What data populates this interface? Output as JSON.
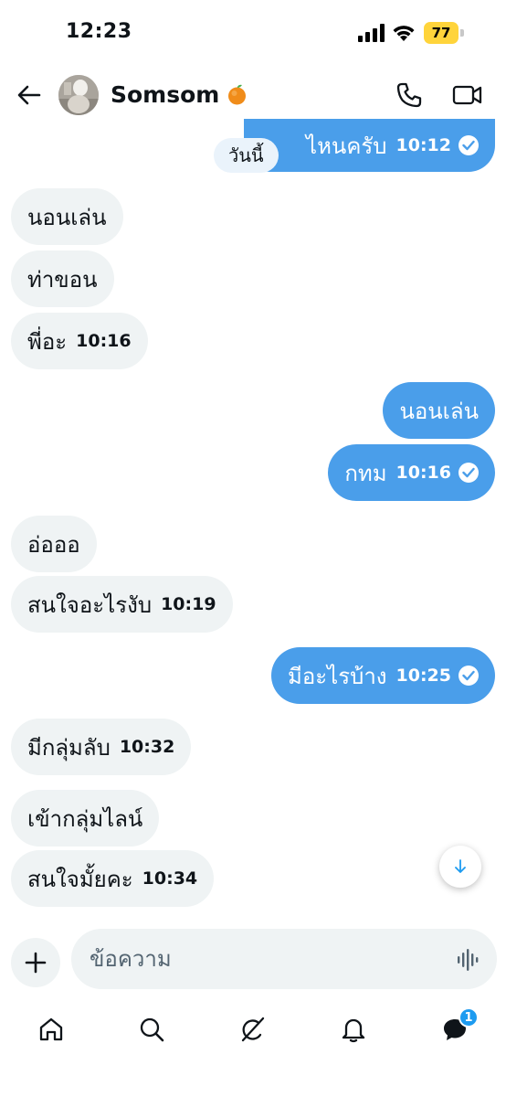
{
  "status_bar": {
    "time": "12:23",
    "battery": "77",
    "battery_color": "#ffd43b"
  },
  "header": {
    "contact_name": "Somsom",
    "contact_emoji": "orange-emoji"
  },
  "colors": {
    "outgoing": "#4a9eea",
    "incoming": "#eff3f4",
    "accent": "#1d9bf0"
  },
  "date_separator": "วันนี้",
  "messages": [
    {
      "text": "ไหนครับ",
      "time": "10:12",
      "direction": "out",
      "read": true
    },
    {
      "text": "นอนเล่น",
      "time": "",
      "direction": "in"
    },
    {
      "text": "ท่าขอน",
      "time": "",
      "direction": "in"
    },
    {
      "text": "พี่อะ",
      "time": "10:16",
      "direction": "in"
    },
    {
      "text": "นอนเล่น",
      "time": "",
      "direction": "out"
    },
    {
      "text": "กทม",
      "time": "10:16",
      "direction": "out",
      "read": true
    },
    {
      "text": "อ่อออ",
      "time": "",
      "direction": "in"
    },
    {
      "text": "สนใจอะไรงับ",
      "time": "10:19",
      "direction": "in"
    },
    {
      "text": "มีอะไรบ้าง",
      "time": "10:25",
      "direction": "out",
      "read": true
    },
    {
      "text": "มีกลุ่มลับ",
      "time": "10:32",
      "direction": "in"
    },
    {
      "text": "เข้ากลุ่มไลน์",
      "time": "",
      "direction": "in"
    },
    {
      "text": "สนใจมั้ยคะ",
      "time": "10:34",
      "direction": "in"
    }
  ],
  "composer": {
    "placeholder": "ข้อความ"
  },
  "nav": {
    "items": [
      "home-icon",
      "search-icon",
      "grok-icon",
      "notifications-icon",
      "messages-icon"
    ],
    "messages_badge": "1"
  }
}
